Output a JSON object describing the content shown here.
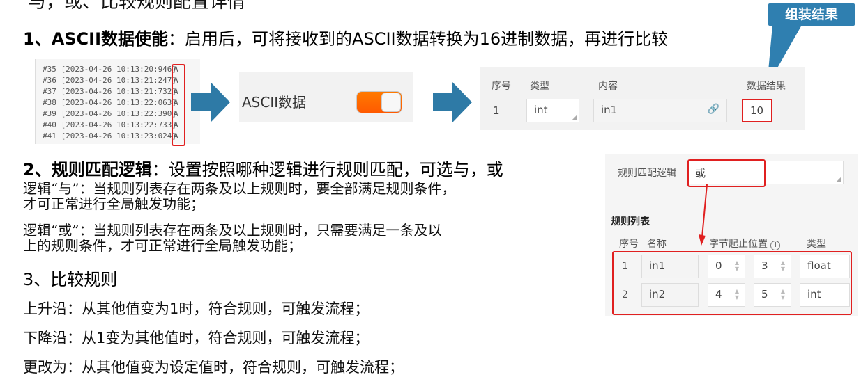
{
  "cut_title": "与，或、比较规则配置详情",
  "section1": {
    "heading": "1、ASCII数据使能",
    "text": "：启用后，可将接收到的ASCII数据转换为16进制数据，再进行比较"
  },
  "log_lines": [
    {
      "text": "#35 [2023-04-26  10:13:20:946]",
      "value": "A"
    },
    {
      "text": "#36 [2023-04-26  10:13:21:247]",
      "value": "A"
    },
    {
      "text": "#37 [2023-04-26  10:13:21:732]",
      "value": "A"
    },
    {
      "text": "#38 [2023-04-26  10:13:22:063]",
      "value": "A"
    },
    {
      "text": "#39 [2023-04-26  10:13:22:390]",
      "value": "A"
    },
    {
      "text": "#40 [2023-04-26  10:13:22:733]",
      "value": "A"
    },
    {
      "text": "#41 [2023-04-26  10:13:23:024]",
      "value": "A"
    }
  ],
  "ascii_toggle": {
    "label": "ASCII数据",
    "enabled": true
  },
  "result_table": {
    "headers": {
      "index": "序号",
      "type": "类型",
      "content": "内容",
      "result": "数据结果"
    },
    "row": {
      "index": "1",
      "type": "int",
      "content": "in1",
      "result": "10"
    }
  },
  "callout": "组装结果",
  "section2": {
    "heading": "2、规则匹配逻辑",
    "text": "：设置按照哪种逻辑进行规则匹配，可选与，或",
    "and_line1": "逻辑“与”：当规则列表存在两条及以上规则时，要全部满足规则条件，",
    "and_line2": "才可正常进行全局触发功能；",
    "or_line1": "逻辑“或”：当规则列表存在两条及以上规则时，只需要满足一条及以",
    "or_line2": "上的规则条件，才可正常进行全局触发功能；"
  },
  "rule_panel": {
    "logic_label": "规则匹配逻辑",
    "logic_value": "或",
    "list_title": "规则列表",
    "headers": {
      "index": "序号",
      "name": "名称",
      "range": "字节起止位置",
      "type": "类型"
    },
    "rows": [
      {
        "index": "1",
        "name": "in1",
        "start": "0",
        "end": "3",
        "type": "float"
      },
      {
        "index": "2",
        "name": "in2",
        "start": "4",
        "end": "5",
        "type": "int"
      }
    ],
    "colors": {
      "highlight": "#e02020",
      "toggle": "#ff6a00",
      "accent": "#2f7fb0"
    }
  },
  "section3": {
    "heading": "3、比较规则",
    "rise": "上升沿：从其他值变为1时，符合规则，可触发流程；",
    "fall": "下降沿：从1变为其他值时，符合规则，可触发流程；",
    "change": "更改为：从其他值变为设定值时，符合规则，可触发流程；"
  }
}
